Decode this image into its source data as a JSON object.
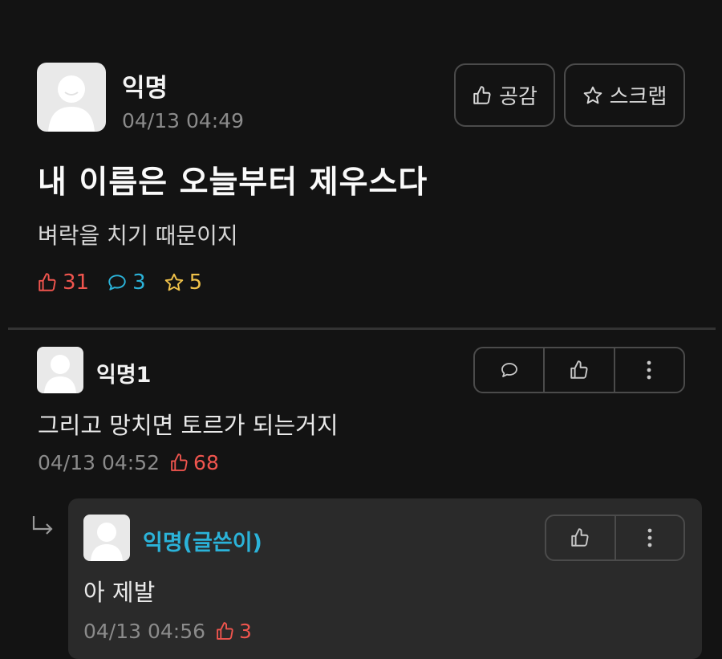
{
  "post": {
    "author": "익명",
    "time": "04/13 04:49",
    "title": "내 이름은 오늘부터 제우스다",
    "body": "벼락을 치기 때문이지",
    "like_button": "공감",
    "scrap_button": "스크랩",
    "likes": "31",
    "comments": "3",
    "scraps": "5"
  },
  "comment": {
    "author": "익명1",
    "text": "그리고 망치면 토르가 되는거지",
    "time": "04/13 04:52",
    "likes": "68"
  },
  "reply": {
    "author": "익명(글쓴이)",
    "text": "아 제발",
    "time": "04/13 04:56",
    "likes": "3"
  },
  "colors": {
    "background": "#131313",
    "like": "#f0554e",
    "comment": "#2bb3d9",
    "scrap": "#f0c24a",
    "author_reply": "#2bb3d9"
  },
  "icons": [
    "avatar-icon",
    "thumbs-up-icon",
    "star-icon",
    "speech-bubble-icon",
    "more-vertical-icon",
    "reply-arrow-icon"
  ]
}
